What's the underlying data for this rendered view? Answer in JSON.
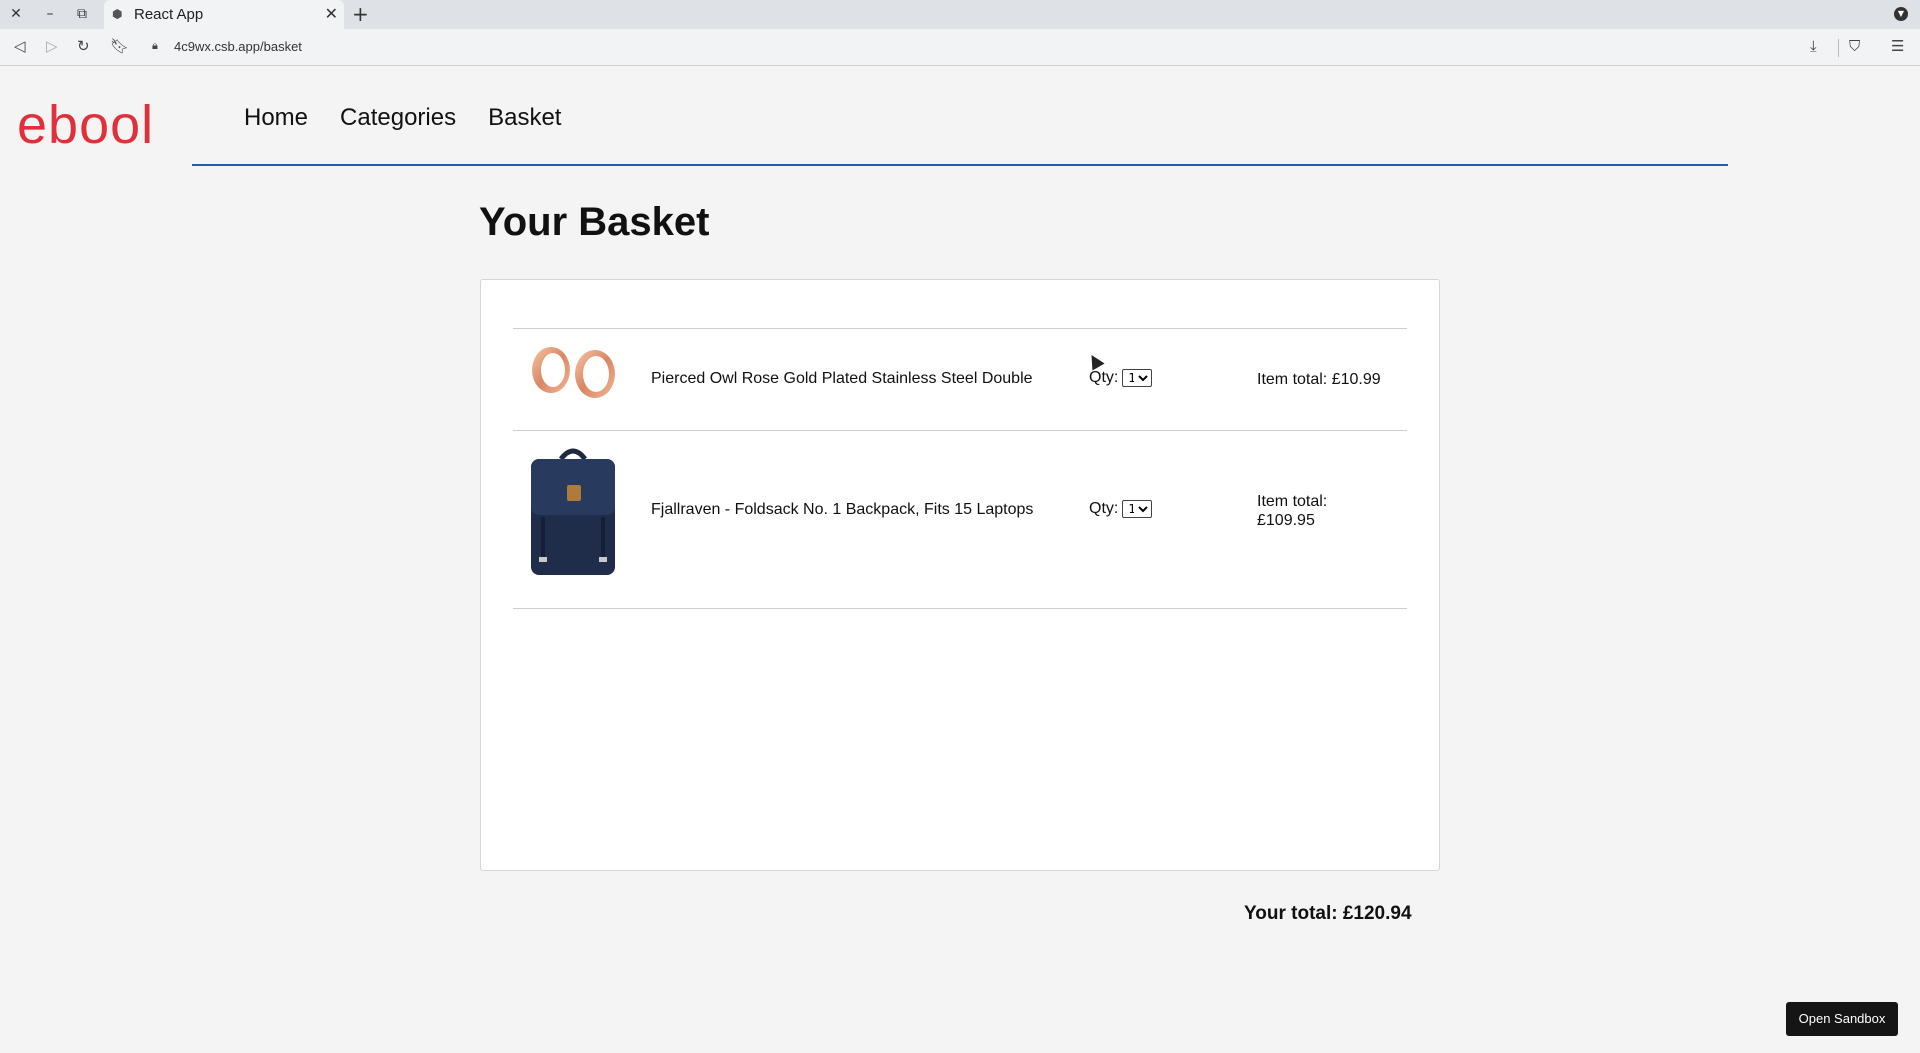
{
  "browser": {
    "tab_title": "React App",
    "url": "4c9wx.csb.app/basket",
    "icons": [
      "close-icon",
      "minimize-icon",
      "restore-icon",
      "favicon-icon",
      "tab-close-icon",
      "new-tab-icon",
      "tab-search-icon",
      "back-icon",
      "forward-icon",
      "reload-icon",
      "bookmark-icon",
      "lock-icon",
      "download-icon",
      "brave-shield-icon",
      "menu-icon"
    ]
  },
  "site": {
    "logo": "ebool",
    "nav": [
      {
        "label": "Home"
      },
      {
        "label": "Categories"
      },
      {
        "label": "Basket"
      }
    ],
    "colors": {
      "logo": "#e0303b",
      "nav_rule": "#1b5fb5"
    }
  },
  "basket": {
    "heading": "Your Basket",
    "items": [
      {
        "title": "Pierced Owl Rose Gold Plated Stainless Steel Double",
        "qty_label": "Qty:",
        "qty_value": "1",
        "total_label": "Item total: £10.99"
      },
      {
        "title": "Fjallraven - Foldsack No. 1 Backpack, Fits 15 Laptops",
        "qty_label": "Qty:",
        "qty_value": "1",
        "total_label_line1": "Item total:",
        "total_label_line2": "£109.95"
      }
    ],
    "grand_total": "Your total: £120.94"
  },
  "sandbox_button": "Open Sandbox"
}
